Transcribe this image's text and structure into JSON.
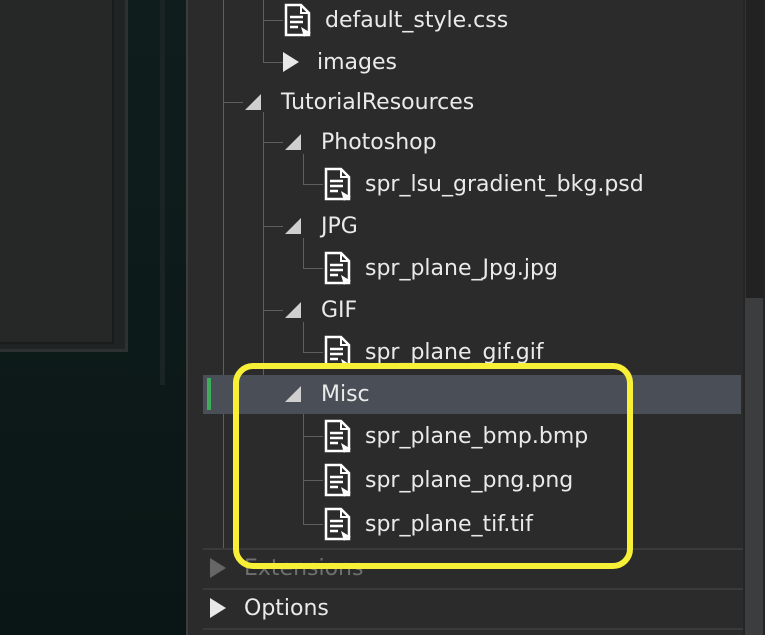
{
  "tree": {
    "items": [
      {
        "label": "default_style.css",
        "type": "file",
        "icon": "file-icon"
      },
      {
        "label": "images",
        "type": "folder",
        "state": "collapsed",
        "icon": "triangle-right-icon"
      },
      {
        "label": "TutorialResources",
        "type": "folder",
        "state": "expanded",
        "icon": "triangle-down-icon"
      },
      {
        "label": "Photoshop",
        "type": "folder",
        "state": "expanded",
        "icon": "triangle-down-icon"
      },
      {
        "label": "spr_lsu_gradient_bkg.psd",
        "type": "file",
        "icon": "file-icon"
      },
      {
        "label": "JPG",
        "type": "folder",
        "state": "expanded",
        "icon": "triangle-down-icon"
      },
      {
        "label": "spr_plane_Jpg.jpg",
        "type": "file",
        "icon": "file-icon"
      },
      {
        "label": "GIF",
        "type": "folder",
        "state": "expanded",
        "icon": "triangle-down-icon"
      },
      {
        "label": "spr_plane_gif.gif",
        "type": "file",
        "icon": "file-icon"
      },
      {
        "label": "Misc",
        "type": "folder",
        "state": "expanded",
        "selected": true,
        "icon": "triangle-down-icon"
      },
      {
        "label": "spr_plane_bmp.bmp",
        "type": "file",
        "icon": "file-icon"
      },
      {
        "label": "spr_plane_png.png",
        "type": "file",
        "icon": "file-icon"
      },
      {
        "label": "spr_plane_tif.tif",
        "type": "file",
        "icon": "file-icon"
      }
    ]
  },
  "sections": {
    "extensions_label": "Extensions",
    "options_label": "Options"
  },
  "colors": {
    "selection": "#4a4f57",
    "selection_marker": "#3fae5b",
    "highlight": "#f7f036",
    "panel": "#2b2b2b"
  }
}
